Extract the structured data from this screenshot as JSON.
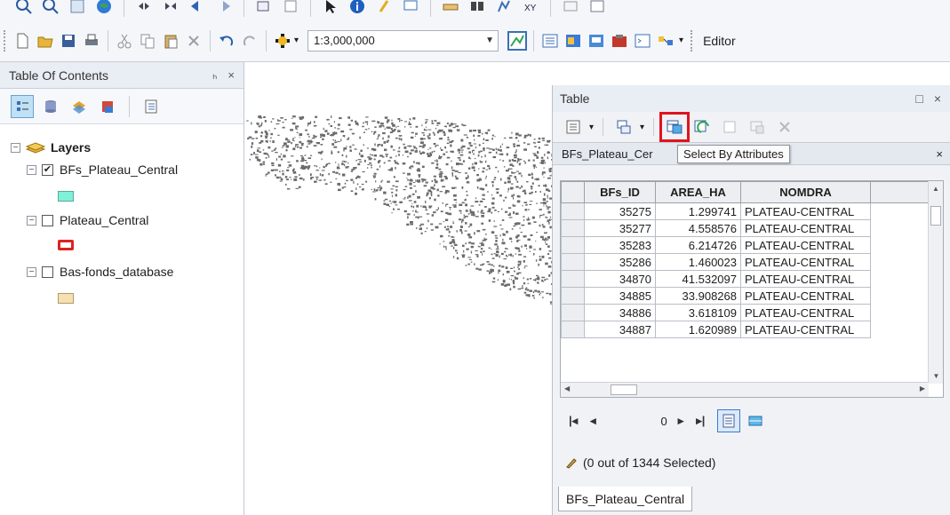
{
  "toolbar": {
    "scale_value": "1:3,000,000",
    "editor_label": "Editor"
  },
  "toc": {
    "title": "Table Of Contents",
    "pin_glyph": "ₕ",
    "close_glyph": "×",
    "root_label": "Layers",
    "layers": [
      {
        "name": "BFs_Plateau_Central",
        "checked": true,
        "swatch_color": "#7ff0da"
      },
      {
        "name": "Plateau_Central",
        "checked": false,
        "swatch_color": "#d9241f"
      },
      {
        "name": "Bas-fonds_database",
        "checked": false,
        "swatch_color": "#f6dfb2"
      }
    ]
  },
  "table_window": {
    "title": "Table",
    "tab_title": "BFs_Plateau_Cer",
    "tooltip": "Select By Attributes",
    "columns": [
      "BFs_ID",
      "AREA_HA",
      "NOMDRA"
    ],
    "rows": [
      [
        "35275",
        "1.299741",
        "PLATEAU-CENTRAL"
      ],
      [
        "35277",
        "4.558576",
        "PLATEAU-CENTRAL"
      ],
      [
        "35283",
        "6.214726",
        "PLATEAU-CENTRAL"
      ],
      [
        "35286",
        "1.460023",
        "PLATEAU-CENTRAL"
      ],
      [
        "34870",
        "41.532097",
        "PLATEAU-CENTRAL"
      ],
      [
        "34885",
        "33.908268",
        "PLATEAU-CENTRAL"
      ],
      [
        "34886",
        "3.618109",
        "PLATEAU-CENTRAL"
      ],
      [
        "34887",
        "1.620989",
        "PLATEAU-CENTRAL"
      ]
    ],
    "record_position": "0",
    "selection_status": "(0 out of 1344 Selected)",
    "bottom_tab": "BFs_Plateau_Central"
  },
  "colors": {
    "highlight_red": "#e0141e",
    "map_features": "#6b6b6b"
  }
}
